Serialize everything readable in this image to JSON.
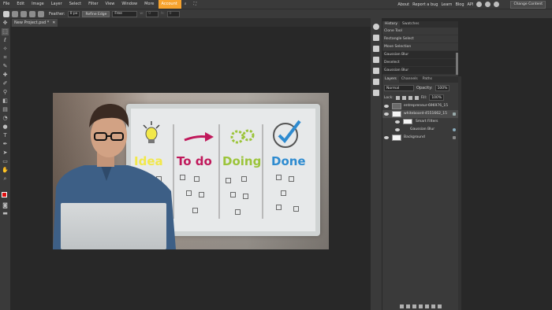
{
  "menu": {
    "items": [
      "File",
      "Edit",
      "Image",
      "Layer",
      "Select",
      "Filter",
      "View",
      "Window",
      "More",
      "Account"
    ],
    "right_links": [
      "About",
      "Report a bug",
      "Learn",
      "Blog",
      "API"
    ],
    "change_content": "Change Content"
  },
  "options": {
    "feather_label": "Feather:",
    "feather_value": "0 px",
    "refine_edge": "Refine Edge",
    "style_value": "Free",
    "w_label": "w:",
    "w_value": "0",
    "h_label": "h:",
    "h_value": "0"
  },
  "tab": {
    "title": "New Project.psd *",
    "close": "✕"
  },
  "history": {
    "tabs": [
      "History",
      "Swatches"
    ],
    "items": [
      "Clone Tool",
      "Rectangle Select",
      "Move Selection",
      "Gaussian Blur",
      "Deselect",
      "Gaussian Blur"
    ]
  },
  "layers": {
    "tabs": [
      "Layers",
      "Channels",
      "Paths"
    ],
    "blend_mode": "Normal",
    "opacity_label": "Opacity:",
    "opacity_value": "100%",
    "lock_label": "Lock:",
    "fill_label": "Fill:",
    "fill_value": "100%",
    "items": [
      "entrepreneur-696976_15",
      "whiteboard-4551662_15",
      "Smart Filters",
      "Gaussian Blur",
      "Background"
    ]
  },
  "board": {
    "headings": [
      "Idea",
      "To do",
      "Doing",
      "Done"
    ],
    "heading_colors": [
      "#f2e84a",
      "#c0195b",
      "#9cc43a",
      "#2e8bd0"
    ]
  },
  "colors": {
    "accent": "#f7a32e",
    "foreground_swatch": "#e01010"
  }
}
